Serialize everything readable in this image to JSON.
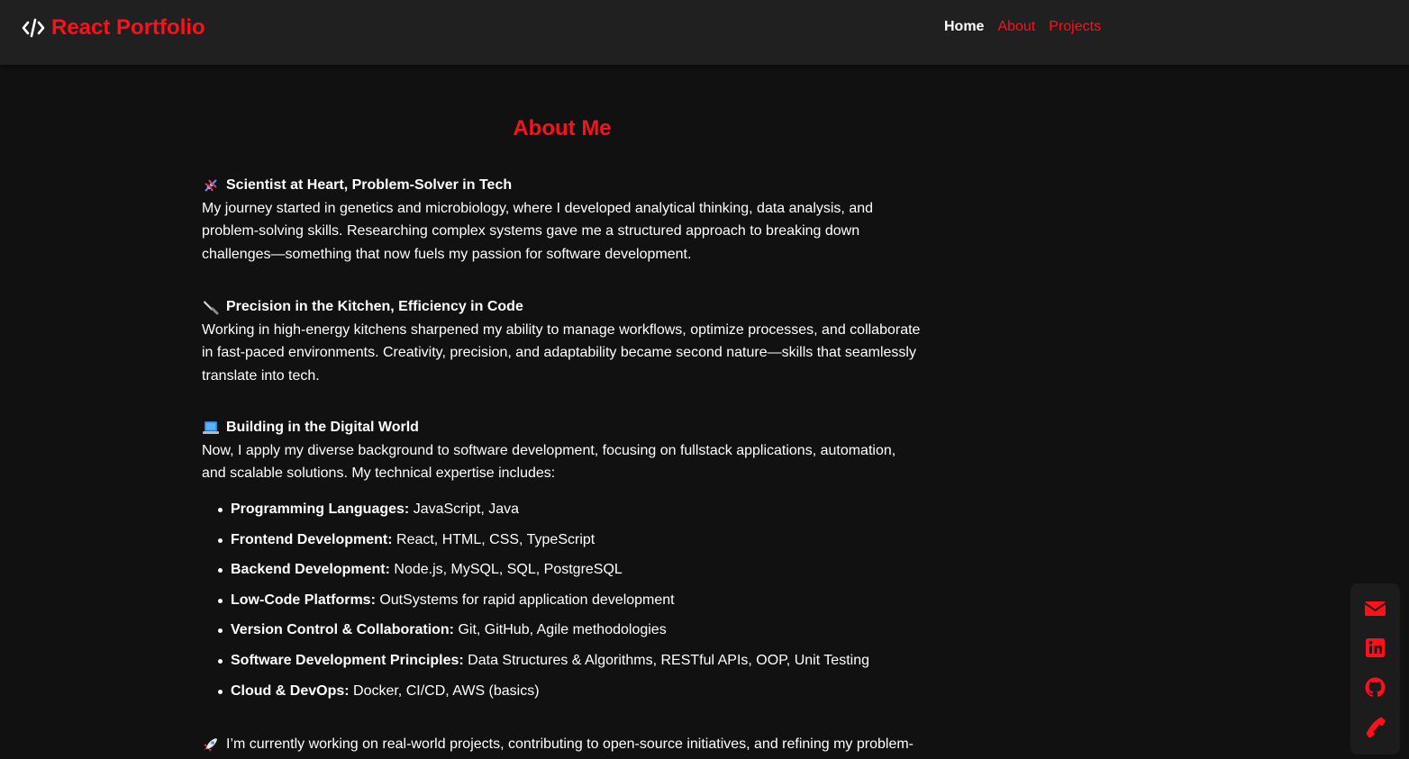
{
  "navbar": {
    "brand": "React Portfolio",
    "links": [
      "Home",
      "About",
      "Projects"
    ]
  },
  "page": {
    "title": "About Me"
  },
  "sections": [
    {
      "heading": "Scientist at Heart, Problem-Solver in Tech",
      "icon": "dna-icon",
      "lines": [
        "My journey started in genetics and microbiology, where I developed analytical thinking, data analysis, and",
        "problem-solving skills. Researching complex systems gave me a structured approach to breaking down",
        "challenges—something that now fuels my passion for software development."
      ]
    },
    {
      "heading": "Precision in the Kitchen, Efficiency in Code",
      "icon": "knife-icon",
      "lines": [
        "Working in high-energy kitchens sharpened my ability to manage workflows, optimize processes, and collaborate",
        "in fast-paced environments. Creativity, precision, and adaptability became second nature—skills that seamlessly",
        "translate into tech."
      ]
    },
    {
      "heading": "Building in the Digital World",
      "icon": "laptop-icon",
      "lines": [
        "Now, I apply my diverse background to software development, focusing on fullstack applications, automation,",
        "and scalable solutions. My technical expertise includes:"
      ]
    }
  ],
  "skills": [
    {
      "label": "Programming Languages:",
      "value": " JavaScript, Java"
    },
    {
      "label": "Frontend Development:",
      "value": " React, HTML, CSS, TypeScript"
    },
    {
      "label": "Backend Development:",
      "value": " Node.js, MySQL, SQL, PostgreSQL"
    },
    {
      "label": "Low-Code Platforms:",
      "value": " OutSystems for rapid application development"
    },
    {
      "label": "Version Control & Collaboration:",
      "value": " Git, GitHub, Agile methodologies"
    },
    {
      "label": "Software Development Principles:",
      "value": " Data Structures & Algorithms, RESTful APIs, OOP, Unit Testing"
    },
    {
      "label": "Cloud & DevOps:",
      "value": " Docker, CI/CD, AWS (basics)"
    }
  ],
  "closing": {
    "icon": "rocket-icon",
    "text": "I’m currently working on real-world projects, contributing to open-source initiatives, and refining my problem-"
  },
  "social": [
    "envelope-icon",
    "linkedin-icon",
    "github-icon",
    "phone-icon"
  ],
  "colors": {
    "accent": "#ff0f1a",
    "background": "#111111",
    "navbar": "#202020",
    "text": "#ffffff"
  }
}
